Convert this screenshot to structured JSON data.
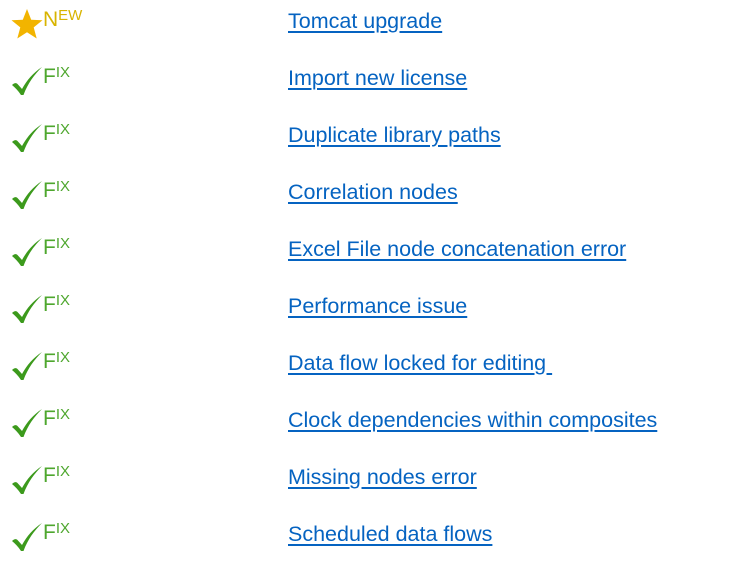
{
  "colors": {
    "new_badge": "#d8b400",
    "fix_badge": "#4ea72e",
    "link": "#0563c1",
    "star_icon": "#f2b400",
    "check_icon": "#3c9a1c"
  },
  "items": [
    {
      "type": "new",
      "icon": "star-icon",
      "badge_first": "N",
      "badge_rest": "EW",
      "link": "Tomcat upgrade"
    },
    {
      "type": "fix",
      "icon": "checkmark-icon",
      "badge_first": "F",
      "badge_rest": "IX",
      "link": "Import new license"
    },
    {
      "type": "fix",
      "icon": "checkmark-icon",
      "badge_first": "F",
      "badge_rest": "IX",
      "link": "Duplicate library paths"
    },
    {
      "type": "fix",
      "icon": "checkmark-icon",
      "badge_first": "F",
      "badge_rest": "IX",
      "link": "Correlation nodes"
    },
    {
      "type": "fix",
      "icon": "checkmark-icon",
      "badge_first": "F",
      "badge_rest": "IX",
      "link": "Excel File node concatenation error"
    },
    {
      "type": "fix",
      "icon": "checkmark-icon",
      "badge_first": "F",
      "badge_rest": "IX",
      "link": "Performance issue"
    },
    {
      "type": "fix",
      "icon": "checkmark-icon",
      "badge_first": "F",
      "badge_rest": "IX",
      "link": "Data flow locked for editing "
    },
    {
      "type": "fix",
      "icon": "checkmark-icon",
      "badge_first": "F",
      "badge_rest": "IX",
      "link": "Clock dependencies within composites"
    },
    {
      "type": "fix",
      "icon": "checkmark-icon",
      "badge_first": "F",
      "badge_rest": "IX",
      "link": "Missing nodes error"
    },
    {
      "type": "fix",
      "icon": "checkmark-icon",
      "badge_first": "F",
      "badge_rest": "IX",
      "link": "Scheduled data flows"
    }
  ]
}
